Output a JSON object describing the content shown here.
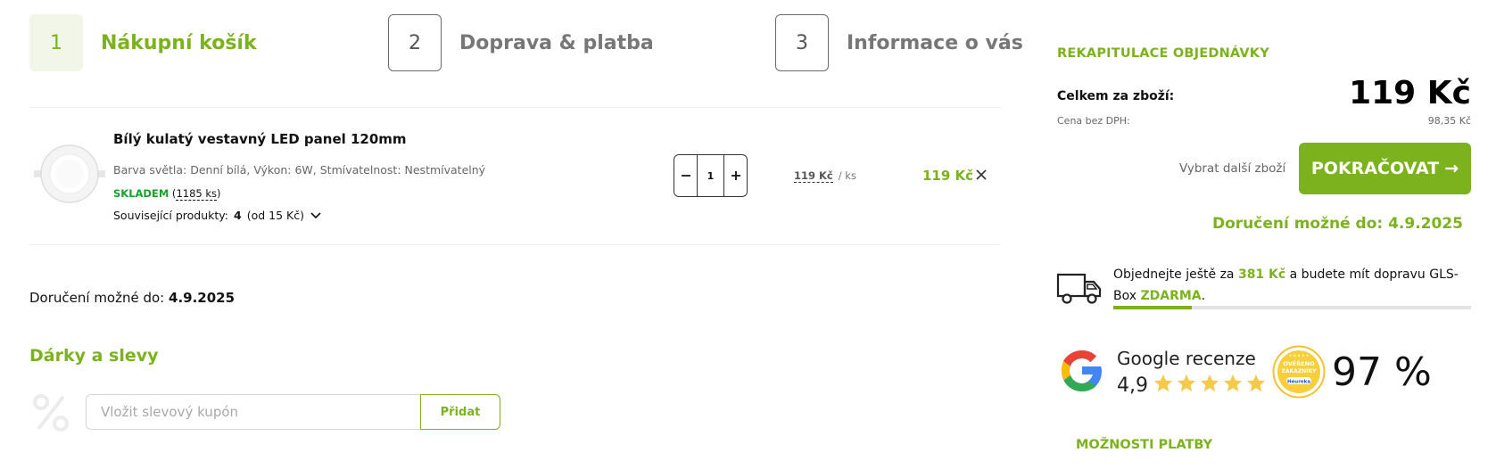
{
  "steps": [
    {
      "number": "1",
      "label": "Nákupní košík"
    },
    {
      "number": "2",
      "label": "Doprava & platba"
    },
    {
      "number": "3",
      "label": "Informace o vás"
    }
  ],
  "product": {
    "name": "Bílý kulatý vestavný LED panel 120mm",
    "attributes": "Barva světla: Denní bílá, Výkon: 6W, Stmívatelnost: Nestmívatelný",
    "stock_status": "SKLADEM",
    "stock_count": "1185 ks",
    "related_prefix": "Související produkty:",
    "related_count": "4",
    "related_suffix": "(od 15 Kč)",
    "quantity": "1",
    "unit_price": "119 Kč",
    "unit_suffix": "/ ks",
    "line_total": "119 Kč"
  },
  "delivery": {
    "label": "Doručení možné do:",
    "date": "4.9.2025"
  },
  "gifts": {
    "title": "Dárky a slevy",
    "coupon_placeholder": "Vložit slevový kupón",
    "add_label": "Přidat"
  },
  "summary": {
    "title": "REKAPITULACE OBJEDNÁVKY",
    "total_label": "Celkem za zboží:",
    "total_value": "119 Kč",
    "net_label": "Cena bez DPH:",
    "net_value": "98,35 Kč",
    "more_goods": "Vybrat další zboží",
    "continue_label": "POKRAČOVAT",
    "continue_arrow": "→",
    "delivery_text": "Doručení možné do: 4.9.2025"
  },
  "shipping": {
    "t1": "Objednejte ještě za ",
    "amount": "381 Kč",
    "t2": " a budete mít dopravu GLS-Box ",
    "free": "ZDARMA",
    "t3": ".",
    "progress": 0.22
  },
  "reviews": {
    "google_label": "Google recenze",
    "google_score": "4,9",
    "stars": 5,
    "heureka_line1": "OVĚŘENO",
    "heureka_line2": "ZÁKAZNÍKY",
    "heureka_brand": "Heureka",
    "heureka_percent": "97 %"
  },
  "payment": {
    "title": "MOŽNOSTI PLATBY"
  },
  "colors": {
    "accent": "#7cb21e",
    "instock": "#19a02c",
    "star": "#f5c94a"
  },
  "icons": [
    "truck-icon",
    "percent-icon",
    "close-icon",
    "chevron-down-icon",
    "google-logo-icon",
    "star-icon",
    "heureka-badge-icon"
  ]
}
